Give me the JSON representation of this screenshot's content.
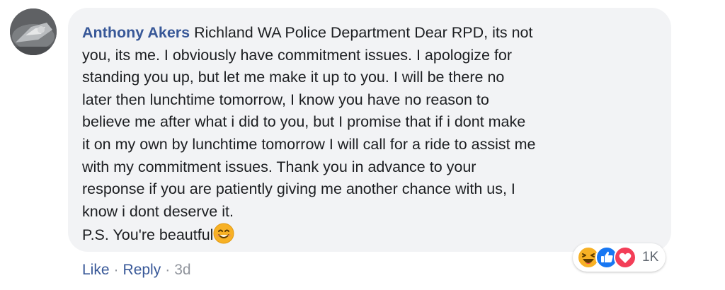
{
  "comment": {
    "author": "Anthony Akers",
    "lines": [
      "Richland WA Police Department Dear RPD, its not",
      "you, its me. I obviously have commitment issues. I apologize for",
      "standing you up, but let me make it up to you. I will be there no",
      "later then lunchtime tomorrow, I know you have no reason to",
      "believe me after what i did to you, but I promise that if i dont make",
      "it on my own by lunchtime tomorrow I will call for a ride to assist me",
      "with my commitment issues. Thank you in advance to your",
      "response if you are patiently giving me another chance with us, I",
      "know i dont deserve it.",
      "P.S. You're beautful"
    ],
    "trailing_emoji": "smiling-face-emoji"
  },
  "reactions": {
    "icons": [
      "haha-icon",
      "like-icon",
      "love-icon"
    ],
    "count": "1K"
  },
  "actions": {
    "like": "Like",
    "reply": "Reply",
    "separator": "·",
    "time": "3d"
  },
  "colors": {
    "author": "#385898",
    "bubble": "#f2f3f5",
    "like_blue": "#1877f2",
    "love_red": "#f33e58",
    "haha_yellow": "#f7b125"
  }
}
